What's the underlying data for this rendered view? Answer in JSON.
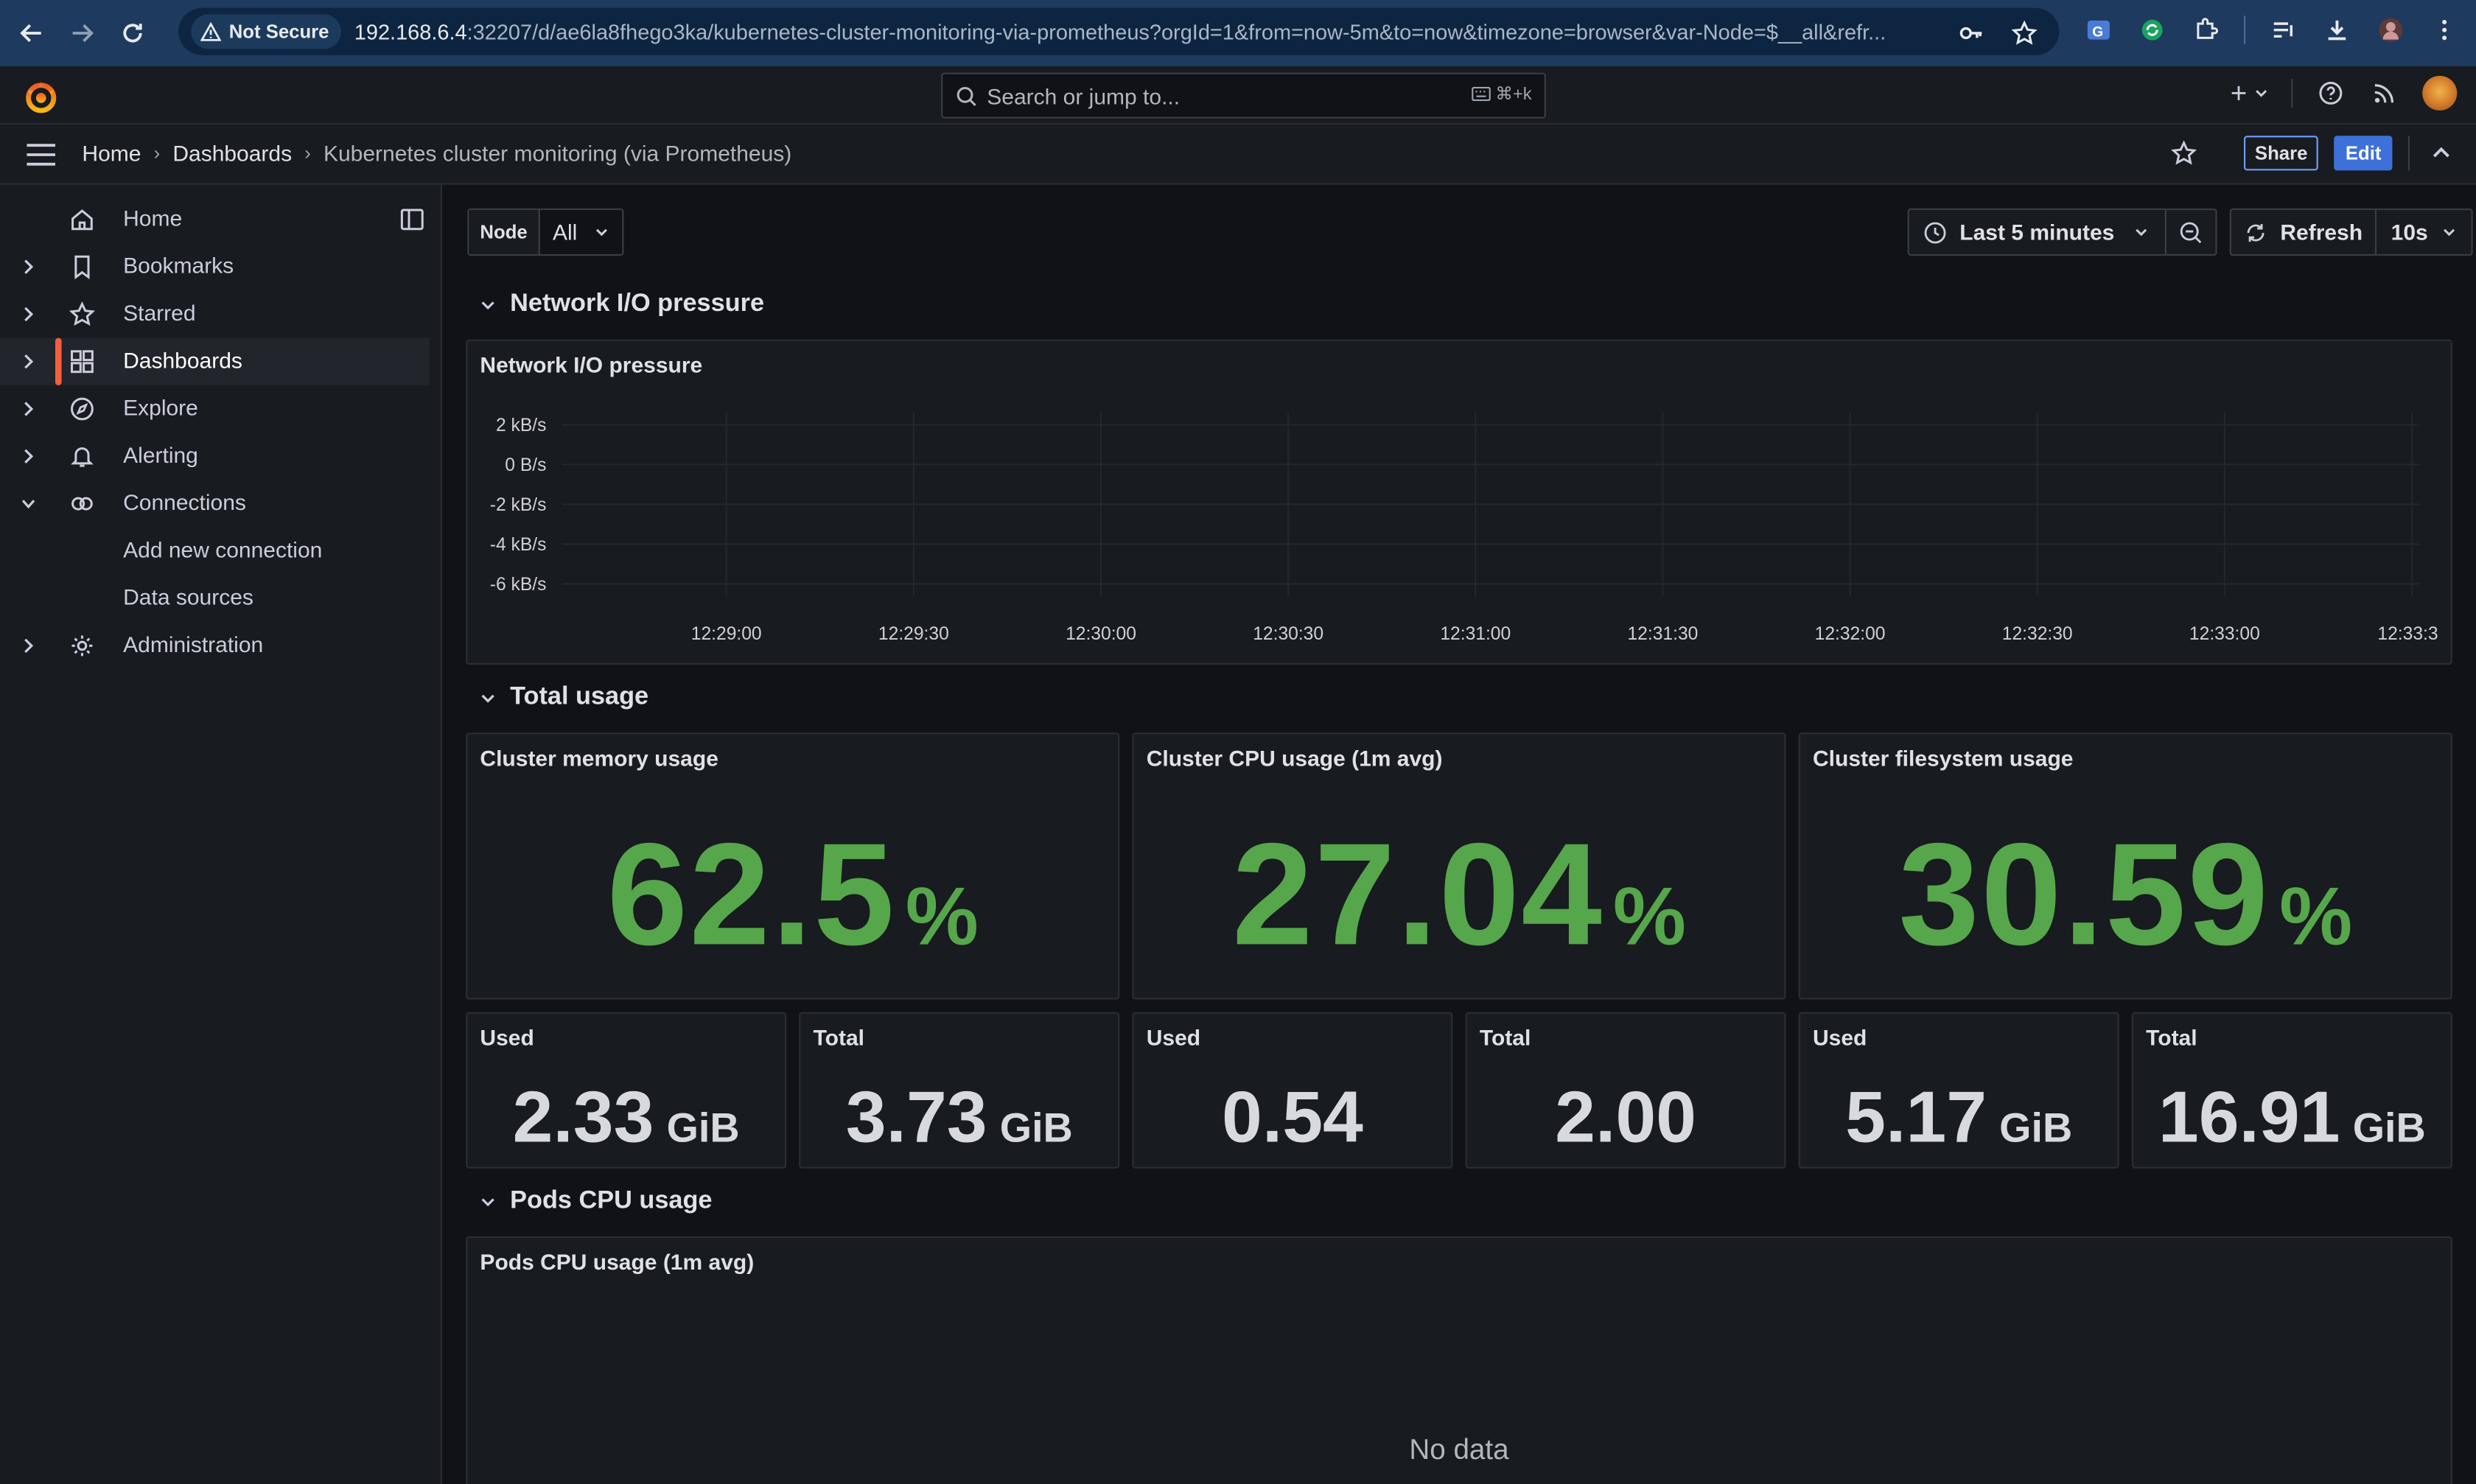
{
  "browser": {
    "security_chip": "Not Secure",
    "url_host": "192.168.6.4",
    "url_rest": ":32207/d/ae6la8fhego3ka/kubernetes-cluster-monitoring-via-prometheus?orgId=1&from=now-5m&to=now&timezone=browser&var-Node=$__all&refr..."
  },
  "topbar": {
    "search_placeholder": "Search or jump to...",
    "search_shortcut": "⌘+k",
    "new_label": "+"
  },
  "breadcrumb": {
    "home": "Home",
    "dashboards": "Dashboards",
    "current": "Kubernetes cluster monitoring (via Prometheus)",
    "share_label": "Share",
    "edit_label": "Edit"
  },
  "sidebar": {
    "items": [
      {
        "label": "Home",
        "icon": "home-icon",
        "expandable": false
      },
      {
        "label": "Bookmarks",
        "icon": "bookmark-icon",
        "expandable": true
      },
      {
        "label": "Starred",
        "icon": "star-icon",
        "expandable": true
      },
      {
        "label": "Dashboards",
        "icon": "apps-icon",
        "expandable": true,
        "active": true
      },
      {
        "label": "Explore",
        "icon": "compass-icon",
        "expandable": true
      },
      {
        "label": "Alerting",
        "icon": "bell-icon",
        "expandable": true
      },
      {
        "label": "Connections",
        "icon": "connections-icon",
        "expandable": true,
        "expanded": true
      },
      {
        "label": "Add new connection",
        "sub": true
      },
      {
        "label": "Data sources",
        "sub": true
      },
      {
        "label": "Administration",
        "icon": "gear-icon",
        "expandable": true
      }
    ]
  },
  "controls": {
    "variable_label": "Node",
    "variable_value": "All",
    "time_range": "Last 5 minutes",
    "refresh_label": "Refresh",
    "refresh_interval": "10s"
  },
  "rows": {
    "network": "Network I/O pressure",
    "total": "Total usage",
    "pods": "Pods CPU usage"
  },
  "panels": {
    "network_title": "Network I/O pressure",
    "memory": {
      "title": "Cluster memory usage",
      "value": "62.5",
      "unit": "%"
    },
    "cpu": {
      "title": "Cluster CPU usage (1m avg)",
      "value": "27.04",
      "unit": "%"
    },
    "fs": {
      "title": "Cluster filesystem usage",
      "value": "30.59",
      "unit": "%"
    },
    "mem_used": {
      "title": "Used",
      "value": "2.33",
      "unit": "GiB"
    },
    "mem_total": {
      "title": "Total",
      "value": "3.73",
      "unit": "GiB"
    },
    "cpu_used": {
      "title": "Used",
      "value": "0.54",
      "unit": ""
    },
    "cpu_total": {
      "title": "Total",
      "value": "2.00",
      "unit": ""
    },
    "fs_used": {
      "title": "Used",
      "value": "5.17",
      "unit": "GiB"
    },
    "fs_total": {
      "title": "Total",
      "value": "16.91",
      "unit": "GiB"
    },
    "pods_title": "Pods CPU usage (1m avg)",
    "pods_nodata": "No data"
  },
  "colors": {
    "stat_green": "#56a64b",
    "accent_blue": "#3d71d9",
    "active_orange": "#f55f3e"
  },
  "chart_data": {
    "type": "line",
    "title": "Network I/O pressure",
    "y_ticks": [
      "2 kB/s",
      "0 B/s",
      "-2 kB/s",
      "-4 kB/s",
      "-6 kB/s"
    ],
    "x_ticks": [
      "12:29:00",
      "12:29:30",
      "12:30:00",
      "12:30:30",
      "12:31:00",
      "12:31:30",
      "12:32:00",
      "12:32:30",
      "12:33:00",
      "12:33:3"
    ],
    "series": [],
    "grid": true
  }
}
